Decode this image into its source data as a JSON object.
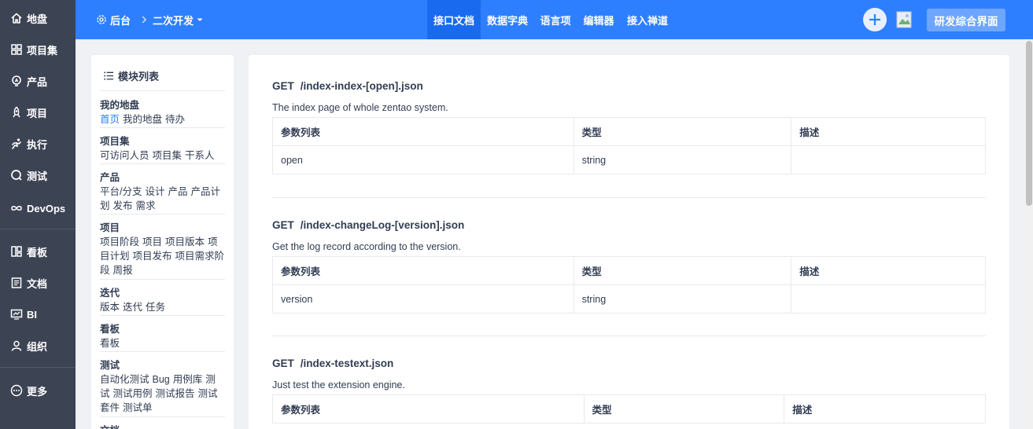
{
  "leftnav": {
    "items": [
      {
        "label": "地盘",
        "icon": "home-icon"
      },
      {
        "label": "项目集",
        "icon": "grid-icon"
      },
      {
        "label": "产品",
        "icon": "lightbulb-icon"
      },
      {
        "label": "项目",
        "icon": "project-icon"
      },
      {
        "label": "执行",
        "icon": "run-icon"
      },
      {
        "label": "测试",
        "icon": "test-icon"
      },
      {
        "label": "DevOps",
        "icon": "infinity-icon"
      },
      {
        "label": "看板",
        "icon": "kanban-icon"
      },
      {
        "label": "文档",
        "icon": "doc-icon"
      },
      {
        "label": "BI",
        "icon": "monitor-icon"
      },
      {
        "label": "组织",
        "icon": "user-icon"
      },
      {
        "label": "更多",
        "icon": "more-icon"
      }
    ]
  },
  "header": {
    "breadcrumb": {
      "home": "后台",
      "current": "二次开发"
    },
    "tabs": [
      {
        "label": "接口文档",
        "active": true
      },
      {
        "label": "数据字典",
        "active": false
      },
      {
        "label": "语言项",
        "active": false
      },
      {
        "label": "编辑器",
        "active": false
      },
      {
        "label": "接入禅道",
        "active": false
      }
    ],
    "vision_button": "研发综合界面"
  },
  "sidebar": {
    "title": "模块列表",
    "groups": [
      {
        "title": "我的地盘",
        "items": [
          "首页",
          "我的地盘",
          "待办"
        ]
      },
      {
        "title": "项目集",
        "items": [
          "可访问人员",
          "项目集",
          "干系人"
        ]
      },
      {
        "title": "产品",
        "items": [
          "平台/分支",
          "设计",
          "产品",
          "产品计划",
          "发布",
          "需求"
        ]
      },
      {
        "title": "项目",
        "items": [
          "项目阶段",
          "项目",
          "项目版本",
          "项目计划",
          "项目发布",
          "项目需求阶段",
          "周报"
        ]
      },
      {
        "title": "迭代",
        "items": [
          "版本",
          "迭代",
          "任务"
        ]
      },
      {
        "title": "看板",
        "items": [
          "看板"
        ]
      },
      {
        "title": "测试",
        "items": [
          "自动化测试",
          "Bug",
          "用例库",
          "测试",
          "测试用例",
          "测试报告",
          "测试套件",
          "测试单"
        ]
      },
      {
        "title": "文档",
        "items": []
      }
    ]
  },
  "main": {
    "table_headers": [
      "参数列表",
      "类型",
      "描述"
    ],
    "apis": [
      {
        "method": "GET",
        "path": "/index-index-[open].json",
        "desc": "The index page of whole zentao system.",
        "rows": [
          [
            "open",
            "string",
            ""
          ]
        ]
      },
      {
        "method": "GET",
        "path": "/index-changeLog-[version].json",
        "desc": "Get the log record according to the version.",
        "rows": [
          [
            "version",
            "string",
            ""
          ]
        ]
      },
      {
        "method": "GET",
        "path": "/index-testext.json",
        "desc": "Just test the extension engine.",
        "rows": []
      }
    ]
  },
  "colors": {
    "brand": "#2e7fff",
    "nav_bg": "#3c4353",
    "link": "#2e7fff"
  }
}
